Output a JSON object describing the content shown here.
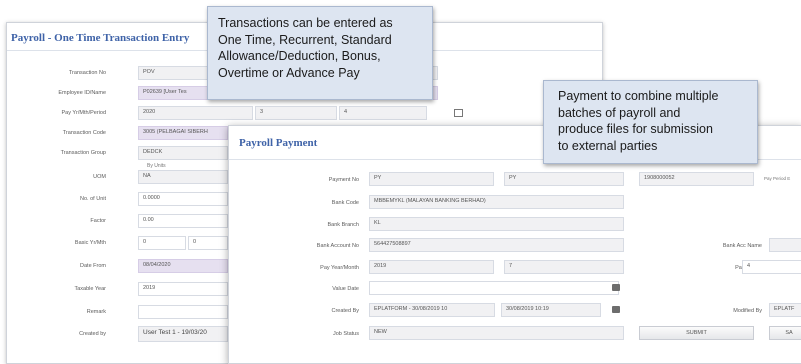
{
  "window1": {
    "title": "Payroll - One Time Transaction Entry",
    "labels": {
      "transaction_no": "Transaction No",
      "employee": "Employee ID/Name",
      "pay_period": "Pay Yr/Mth/Period",
      "transaction_code": "Transaction Code",
      "transaction_group": "Transaction Group",
      "by_units": "By Units",
      "uom": "UOM",
      "no_of_unit": "No. of Unit",
      "factor": "Factor",
      "basic": "Basic Yr/Mth",
      "date_from": "Date From",
      "taxable_year": "Taxable Year",
      "remark": "Remark",
      "created_by": "Created by"
    },
    "values": {
      "transaction_no": "POV",
      "employee": "P02639  [User Tes",
      "pay_year": "2020",
      "pay_month": "3",
      "pay_period": "4",
      "transaction_code": "3005 (PELBAGAI SIBERH",
      "transaction_group": "DEDCK",
      "uom": "NA",
      "no_of_unit": "0.0000",
      "factor": "0.00",
      "basic_year": "0",
      "basic_month": "0",
      "date_from": "08/04/2020",
      "taxable_year": "2019",
      "remark": "",
      "created_by": "User Test 1 - 19/03/20"
    }
  },
  "window2": {
    "title": "Payroll Payment",
    "labels": {
      "payment_no": "Payment No",
      "bank_code": "Bank Code",
      "bank_branch": "Bank Branch",
      "bank_account_no": "Bank Account No",
      "pay_year_month": "Pay Year/Month",
      "value_date": "Value Date",
      "created_by": "Created By",
      "job_status": "Job Status",
      "pay_period_e": "Pay Period E",
      "bank_acc_name": "Bank Acc Name",
      "pay_period": "Pay Period",
      "modified_by": "Modified By"
    },
    "values": {
      "payment_no_1": "PY",
      "payment_no_2": "PY",
      "payment_no_3": "1908000052",
      "bank_code": "MBBEMYKL (MALAYAN BANKING BERHAD)",
      "bank_branch": "KL",
      "bank_account_no": "564427508897",
      "pay_year": "2019",
      "pay_month": "7",
      "value_date": "",
      "created_by": "EPLATFORM - 30/08/2019 10",
      "created_date": "30/08/2019 10:19",
      "job_status": "NEW",
      "bank_acc_name": "",
      "pay_period": "4",
      "modified_by": "EPLATF"
    },
    "buttons": {
      "submit": "SUBMIT",
      "second": "SA"
    }
  },
  "callout1": {
    "lines": [
      "Transactions can be entered as",
      "One Time, Recurrent, Standard",
      "Allowance/Deduction, Bonus,",
      "Overtime or Advance Pay"
    ]
  },
  "callout2": {
    "lines": [
      "Payment to combine multiple",
      "batches of payroll and",
      "produce files for submission",
      "to external parties"
    ]
  },
  "colors": {
    "title_blue": "#3f63a8",
    "callout_bg": "#dde5f1",
    "field_purple": "#e6e0f0",
    "field_grey": "#f1f1f3"
  }
}
